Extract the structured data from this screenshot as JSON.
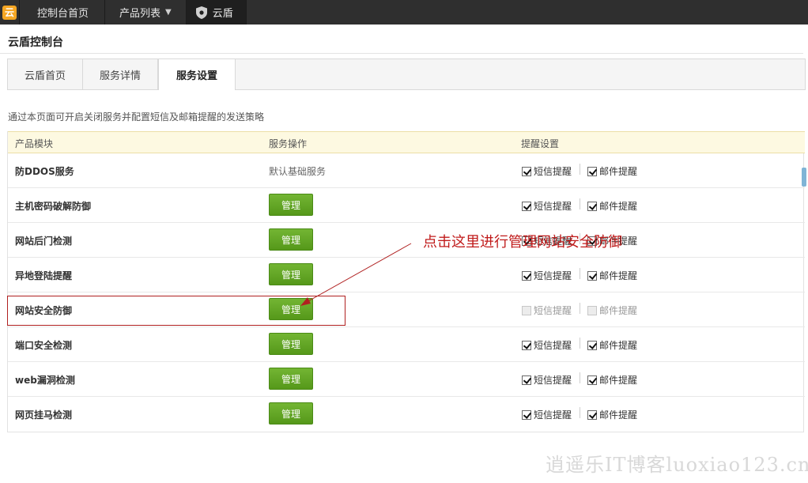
{
  "topbar": {
    "logo_glyph": "云",
    "items": [
      {
        "label": "控制台首页"
      },
      {
        "label": "产品列表"
      },
      {
        "label": "云盾"
      }
    ]
  },
  "page_title": "云盾控制台",
  "tabs": [
    {
      "label": "云盾首页"
    },
    {
      "label": "服务详情"
    },
    {
      "label": "服务设置"
    }
  ],
  "description": "通过本页面可开启关闭服务并配置短信及邮箱提醒的发送策略",
  "table": {
    "headers": [
      "产品模块",
      "服务操作",
      "提醒设置"
    ],
    "sms_label": "短信提醒",
    "email_label": "邮件提醒",
    "manage_label": "管理",
    "rows": [
      {
        "name": "防DDOS服务",
        "operation": "默认基础服务",
        "sms": true,
        "email": true
      },
      {
        "name": "主机密码破解防御",
        "operation": "管理",
        "sms": true,
        "email": true
      },
      {
        "name": "网站后门检测",
        "operation": "管理",
        "sms": true,
        "email": true
      },
      {
        "name": "异地登陆提醒",
        "operation": "管理",
        "sms": true,
        "email": true
      },
      {
        "name": "网站安全防御",
        "operation": "管理",
        "sms": false,
        "email": false
      },
      {
        "name": "端口安全检测",
        "operation": "管理",
        "sms": true,
        "email": true
      },
      {
        "name": "web漏洞检测",
        "operation": "管理",
        "sms": true,
        "email": true
      },
      {
        "name": "网页挂马检测",
        "operation": "管理",
        "sms": true,
        "email": true
      }
    ]
  },
  "annotation": {
    "text": "点击这里进行管理网站安全防御",
    "color": "#c01b1b"
  },
  "watermark": "逍遥乐IT博客luoxiao123.cn",
  "colors": {
    "topbar": "#2f2f2f",
    "manage_button": "#5fa523",
    "table_header": "#fdf9e1"
  }
}
